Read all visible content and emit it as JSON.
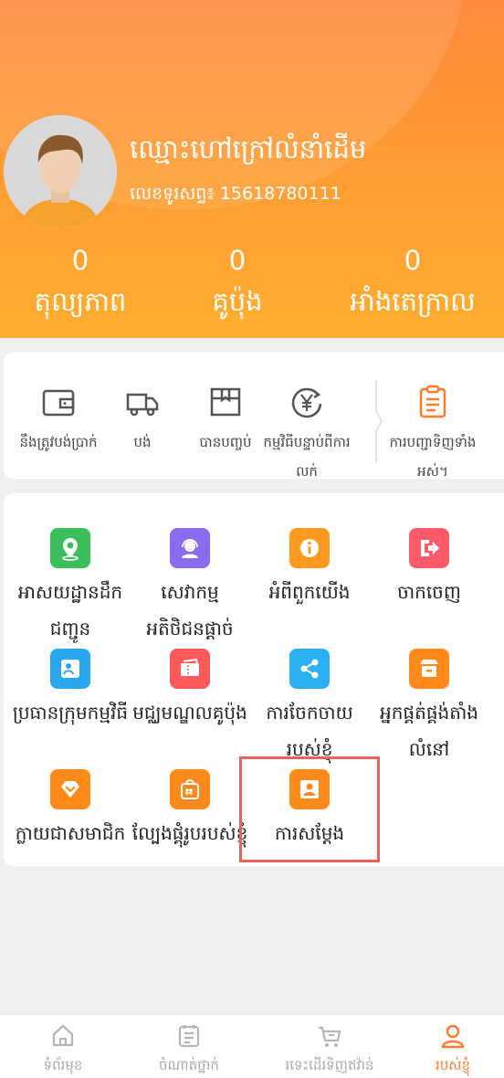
{
  "profile": {
    "name": "ឈ្មោះហៅក្រៅលំនាំដើម",
    "phone": "លេខទូរសព្ទ៖ 15618780111"
  },
  "stats": [
    {
      "value": "0",
      "label": "តុល្យភាព"
    },
    {
      "value": "0",
      "label": "គូប៉ុង"
    },
    {
      "value": "0",
      "label": "អាំងតេក្រាល"
    }
  ],
  "orders": [
    {
      "label": "នឹងត្រូវបង់ប្រាក់",
      "icon": "wallet-icon"
    },
    {
      "label": "បង់",
      "icon": "truck-icon"
    },
    {
      "label": "បានបញ្ចប់",
      "icon": "box-icon"
    },
    {
      "label": "កម្មវិធីបន្ទាប់ពីការលក់",
      "icon": "yen-refund-icon"
    },
    {
      "label": "ការបញ្ជាទិញទាំងអស់។",
      "icon": "clipboard-icon"
    }
  ],
  "services": [
    {
      "label": "អាសយដ្ឋានដឹកជញ្ជូន",
      "icon": "location-icon",
      "color": "#3bbf5b"
    },
    {
      "label": "សេវាកម្មអតិថិជនផ្តាច់",
      "icon": "headset-icon",
      "color": "#8a6cf0"
    },
    {
      "label": "អំពីពួកយើង",
      "icon": "info-icon",
      "color": "#ff9a1f"
    },
    {
      "label": "ចាកចេញ",
      "icon": "logout-icon",
      "color": "#ff5a6a"
    },
    {
      "label": "ប្រធានក្រុមកម្មវិធី",
      "icon": "team-leader-icon",
      "color": "#29a7f0"
    },
    {
      "label": "មជ្ឈមណ្ឌលគូប៉ុង",
      "icon": "coupon-icon",
      "color": "#ff5a5a"
    },
    {
      "label": "ការចែកចាយរបស់ខ្ញុំ",
      "icon": "share-icon",
      "color": "#2bb0f2"
    },
    {
      "label": "អ្នកផ្គត់ផ្គង់តាំងលំនៅ",
      "icon": "store-icon",
      "color": "#ff8a1a"
    },
    {
      "label": "ក្លាយជាសមាជិក",
      "icon": "diamond-icon",
      "color": "#ff8a1a"
    },
    {
      "label": "ល្បែងផ្គុំរូបរបស់ខ្ញុំ",
      "icon": "puzzle-bag-icon",
      "color": "#ff8a1a"
    },
    {
      "label": "ការសម្តែង",
      "icon": "performance-icon",
      "color": "#ff8a1a"
    }
  ],
  "tabs": [
    {
      "label": "ទំព័រមុខ",
      "icon": "home-icon"
    },
    {
      "label": "ចំណាត់ថ្នាក់",
      "icon": "category-icon"
    },
    {
      "label": "រទេះដើរទិញឥវ៉ាន់",
      "icon": "cart-icon"
    },
    {
      "label": "របស់ខ្ញុំ",
      "icon": "user-icon",
      "active": true
    }
  ],
  "colors": {
    "accent": "#ff7a2c",
    "header_top": "#ff8a3d",
    "header_bottom": "#ffae2f"
  }
}
